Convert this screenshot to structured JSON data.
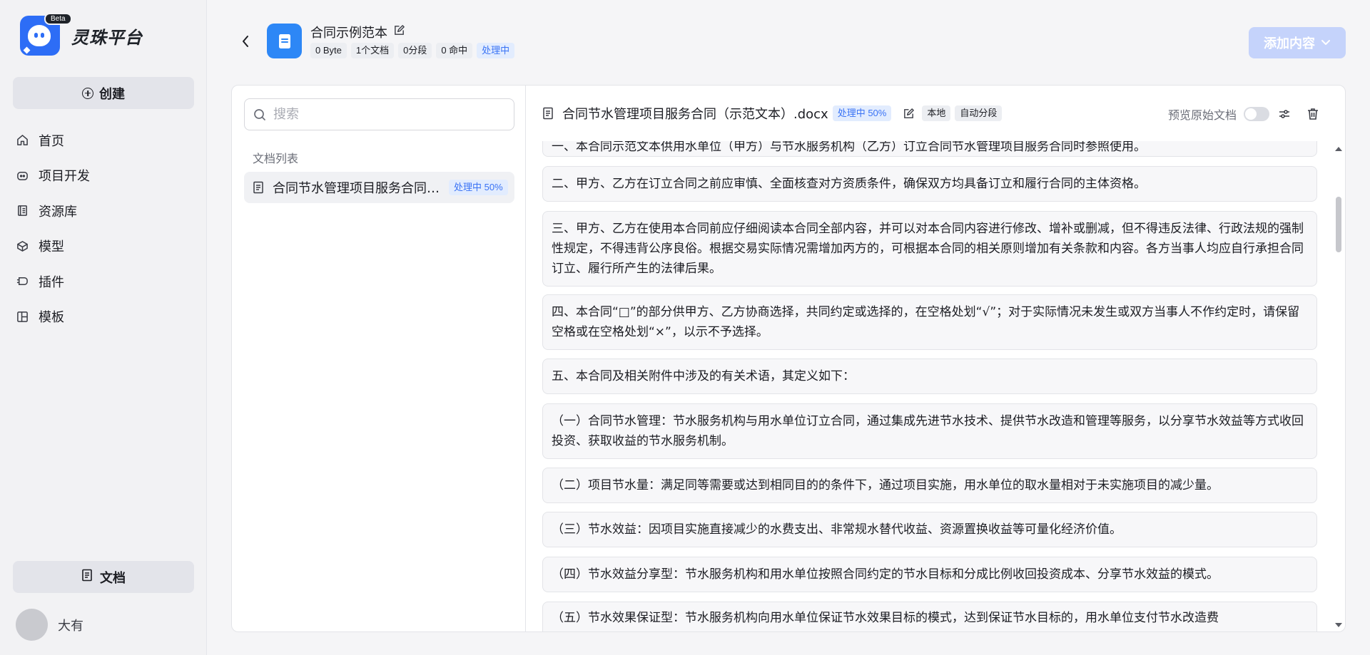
{
  "sidebar": {
    "brand": "灵珠平台",
    "beta": "Beta",
    "create_label": "创建",
    "items": [
      {
        "label": "首页",
        "icon": "home-icon"
      },
      {
        "label": "项目开发",
        "icon": "project-icon"
      },
      {
        "label": "资源库",
        "icon": "library-icon"
      },
      {
        "label": "模型",
        "icon": "model-icon"
      },
      {
        "label": "插件",
        "icon": "plugin-icon"
      },
      {
        "label": "模板",
        "icon": "template-icon"
      }
    ],
    "docs_label": "文档",
    "user_name": "大有"
  },
  "header": {
    "kb_title": "合同示例范本",
    "tags": [
      "0 Byte",
      "1个文档",
      "0分段",
      "0 命中",
      "处理中"
    ],
    "add_button": "添加内容",
    "colors": {
      "accent": "#2d6df6",
      "add_button_bg": "#c5d3fb",
      "status_tag_text": "#3a73f5"
    }
  },
  "left_pane": {
    "search_placeholder": "搜索",
    "list_title": "文档列表",
    "doc_name": "合同节水管理项目服务合同（示范文本）.docx",
    "doc_status": "处理中 50%"
  },
  "right_pane": {
    "doc_title": "合同节水管理项目服务合同（示范文本）.docx",
    "status": "处理中 50%",
    "tag_local": "本地",
    "tag_auto": "自动分段",
    "preview_label": "预览原始文档",
    "preview_enabled": false,
    "chunks": [
      "一、本合同示范文本供用水单位（甲方）与节水服务机构（乙方）订立合同节水管理项目服务合同时参照使用。",
      "二、甲方、乙方在订立合同之前应审慎、全面核查对方资质条件，确保双方均具备订立和履行合同的主体资格。",
      "三、甲方、乙方在使用本合同前应仔细阅读本合同全部内容，并可以对本合同内容进行修改、增补或删减，但不得违反法律、行政法规的强制性规定，不得违背公序良俗。根据交易实际情况需增加丙方的，可根据本合同的相关原则增加有关条款和内容。各方当事人均应自行承担合同订立、履行所产生的法律后果。",
      "四、本合同“□”的部分供甲方、乙方协商选择，共同约定或选择的，在空格处划“√”；对于实际情况未发生或双方当事人不作约定时，请保留空格或在空格处划“×”，以示不予选择。",
      "五、本合同及相关附件中涉及的有关术语，其定义如下：",
      "（一）合同节水管理：节水服务机构与用水单位订立合同，通过集成先进节水技术、提供节水改造和管理等服务，以分享节水效益等方式收回投资、获取收益的节水服务机制。",
      "（二）项目节水量：满足同等需要或达到相同目的的条件下，通过项目实施，用水单位的取水量相对于未实施项目的减少量。",
      "（三）节水效益：因项目实施直接减少的水费支出、非常规水替代收益、资源置换收益等可量化经济价值。",
      "（四）节水效益分享型：节水服务机构和用水单位按照合同约定的节水目标和分成比例收回投资成本、分享节水效益的模式。",
      "（五）节水效果保证型：节水服务机构向用水单位保证节水效果目标的模式，达到保证节水目标的，用水单位支付节水改造费"
    ]
  }
}
